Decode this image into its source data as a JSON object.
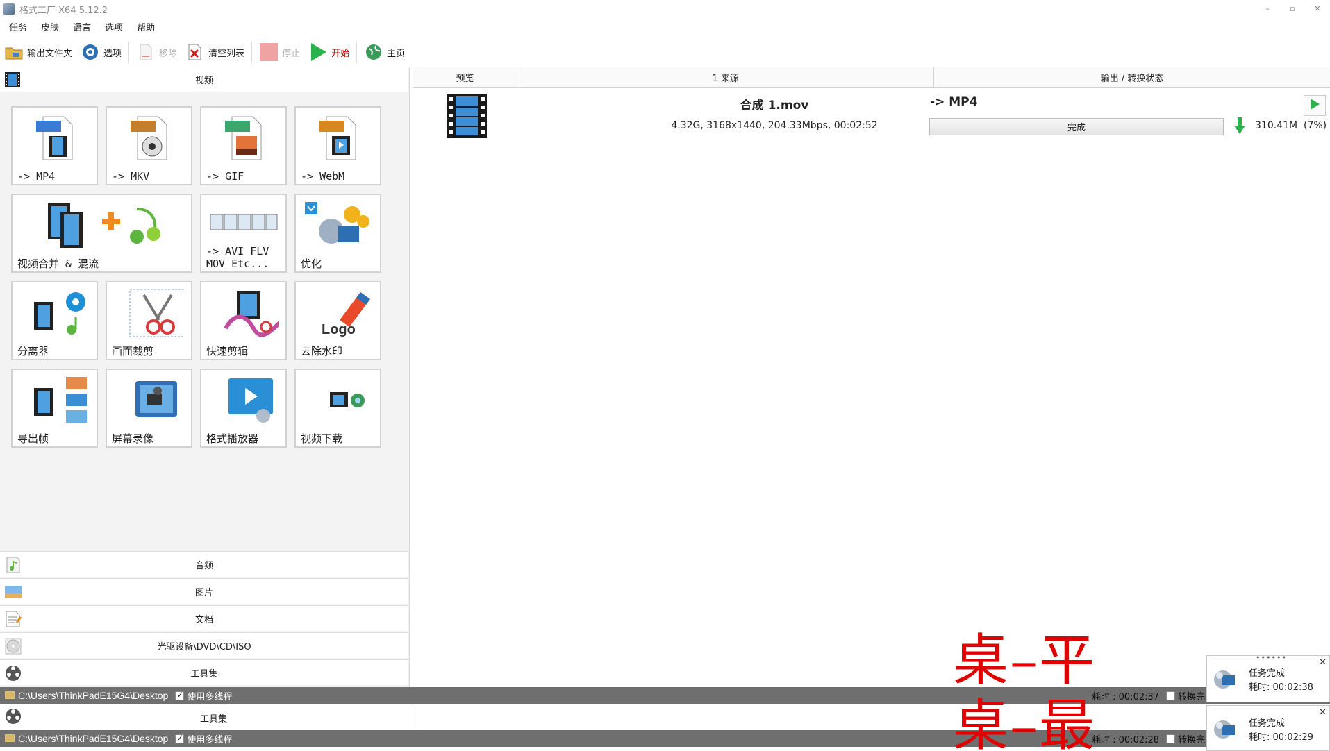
{
  "window": {
    "title": "格式工厂 X64 5.12.2",
    "controls": [
      "–",
      "▫",
      "✕"
    ]
  },
  "menu": [
    "任务",
    "皮肤",
    "语言",
    "选项",
    "帮助"
  ],
  "toolbar": {
    "output_folder": "输出文件夹",
    "options": "选项",
    "remove": "移除",
    "clear_list": "清空列表",
    "stop": "停止",
    "start": "开始",
    "home": "主页"
  },
  "left": {
    "header": "视频",
    "tiles": [
      {
        "label": "-> MP4",
        "badge": "MP4",
        "badge_color": "#3a7bd5"
      },
      {
        "label": "-> MKV",
        "badge": "MKV",
        "badge_color": "#c47f2c"
      },
      {
        "label": "-> GIF",
        "badge": "GIF",
        "badge_color": "#3aa76d"
      },
      {
        "label": "-> WebM",
        "badge": "WebM",
        "badge_color": "#d6881f"
      },
      {
        "label": "视频合并 & 混流"
      },
      {
        "label": "-> AVI FLV\nMOV Etc..."
      },
      {
        "label": "优化"
      },
      {
        "label": "分离器"
      },
      {
        "label": "画面裁剪"
      },
      {
        "label": "快速剪辑"
      },
      {
        "label": "去除水印"
      },
      {
        "label": "导出帧"
      },
      {
        "label": "屏幕录像"
      },
      {
        "label": "格式播放器"
      },
      {
        "label": "视频下载"
      }
    ],
    "categories": [
      "音频",
      "图片",
      "文档",
      "光驱设备\\DVD\\CD\\ISO",
      "工具集"
    ]
  },
  "task_list": {
    "columns": [
      "预览",
      "1 来源",
      "输出 / 转换状态"
    ],
    "rows": [
      {
        "source_name": "合成 1.mov",
        "source_info": "4.32G, 3168x1440, 204.33Mbps, 00:02:52",
        "output_format": "-> MP4",
        "status": "完成",
        "output_size": "310.41M",
        "output_ratio": "(7%)"
      }
    ]
  },
  "statusbars": [
    {
      "path": "C:\\Users\\ThinkPadE15G4\\Desktop",
      "multithread": "使用多线程",
      "elapsed": "耗时 : 00:02:37",
      "done": "转换完"
    },
    {
      "path": "C:\\Users\\ThinkPadE15G4\\Desktop",
      "multithread": "使用多线程",
      "elapsed": "耗时 : 00:02:28",
      "done": "转换完"
    }
  ],
  "dup_category": "工具集",
  "overlay": [
    "桌–平",
    "桌–最"
  ],
  "notifications": [
    {
      "title": "任务完成",
      "time": "耗时: 00:02:38"
    },
    {
      "title": "任务完成",
      "time": "耗时: 00:02:29"
    }
  ],
  "colors": {
    "start_green": "#2bb24c",
    "overlay_red": "#e00000",
    "statusbar": "#6f6f6f"
  }
}
